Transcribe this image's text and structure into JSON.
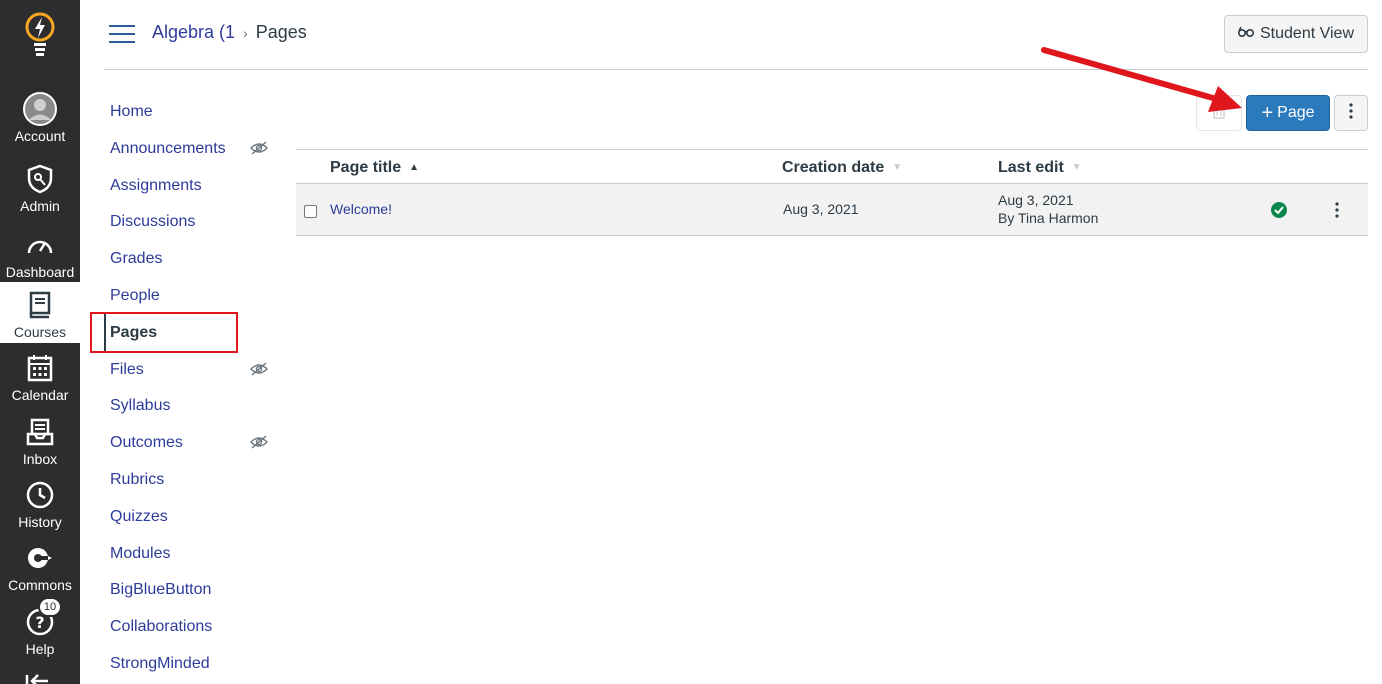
{
  "global_nav": {
    "items": [
      {
        "label": "Account",
        "icon": "account-avatar-icon"
      },
      {
        "label": "Admin",
        "icon": "admin-shield-icon"
      },
      {
        "label": "Dashboard",
        "icon": "dashboard-gauge-icon"
      },
      {
        "label": "Courses",
        "icon": "courses-book-icon"
      },
      {
        "label": "Calendar",
        "icon": "calendar-icon"
      },
      {
        "label": "Inbox",
        "icon": "inbox-icon"
      },
      {
        "label": "History",
        "icon": "history-clock-icon"
      },
      {
        "label": "Commons",
        "icon": "commons-icon"
      },
      {
        "label": "Help",
        "icon": "help-icon"
      }
    ],
    "help_badge": "10",
    "active": "Courses"
  },
  "header": {
    "course_crumb": "Algebra (1",
    "current_crumb": "Pages",
    "student_view_label": "Student View"
  },
  "course_nav": {
    "items": [
      {
        "label": "Home",
        "hidden": false
      },
      {
        "label": "Announcements",
        "hidden": true
      },
      {
        "label": "Assignments",
        "hidden": false
      },
      {
        "label": "Discussions",
        "hidden": false
      },
      {
        "label": "Grades",
        "hidden": false
      },
      {
        "label": "People",
        "hidden": false
      },
      {
        "label": "Pages",
        "hidden": false,
        "active": true
      },
      {
        "label": "Files",
        "hidden": true
      },
      {
        "label": "Syllabus",
        "hidden": false
      },
      {
        "label": "Outcomes",
        "hidden": true
      },
      {
        "label": "Rubrics",
        "hidden": false
      },
      {
        "label": "Quizzes",
        "hidden": false
      },
      {
        "label": "Modules",
        "hidden": false
      },
      {
        "label": "BigBlueButton",
        "hidden": false
      },
      {
        "label": "Collaborations",
        "hidden": false
      },
      {
        "label": "StrongMinded",
        "hidden": false
      }
    ]
  },
  "toolbar": {
    "add_page_label": "Page",
    "accent_color": "#2b7abc"
  },
  "table": {
    "columns": [
      {
        "label": "Page title",
        "sort": "ascending"
      },
      {
        "label": "Creation date",
        "sort": "none"
      },
      {
        "label": "Last edit",
        "sort": "none"
      }
    ],
    "rows": [
      {
        "title": "Welcome!",
        "created": "Aug 3, 2021",
        "edit_date": "Aug 3, 2021",
        "edit_by": "By Tina Harmon",
        "published": true
      }
    ]
  }
}
